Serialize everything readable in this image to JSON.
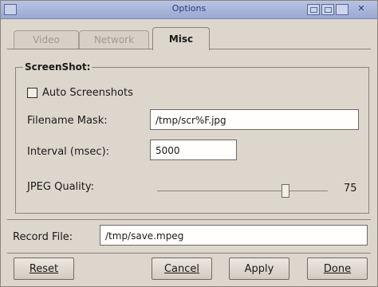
{
  "window": {
    "title": "Options"
  },
  "tabs": [
    {
      "label": "Video",
      "active": false
    },
    {
      "label": "Network",
      "active": false
    },
    {
      "label": "Misc",
      "active": true
    }
  ],
  "screenshot_group": {
    "title": "ScreenShot:",
    "auto_screenshots": {
      "label": "Auto Screenshots",
      "checked": false
    },
    "filename_mask": {
      "label": "Filename Mask:",
      "value": "/tmp/scr%F.jpg"
    },
    "interval": {
      "label": "Interval (msec):",
      "value": "5000"
    },
    "jpeg_quality": {
      "label": "JPEG Quality:",
      "value": "75",
      "fraction": 0.75
    }
  },
  "record_file": {
    "label": "Record File:",
    "value": "/tmp/save.mpeg"
  },
  "buttons": {
    "reset": "Reset",
    "cancel": "Cancel",
    "apply": "Apply",
    "done": "Done"
  },
  "icons": {
    "window_menu": "window-menu-icon",
    "minimize": "minimize-icon",
    "maximize": "maximize-icon",
    "shade": "shade-icon",
    "close": "close-icon"
  }
}
